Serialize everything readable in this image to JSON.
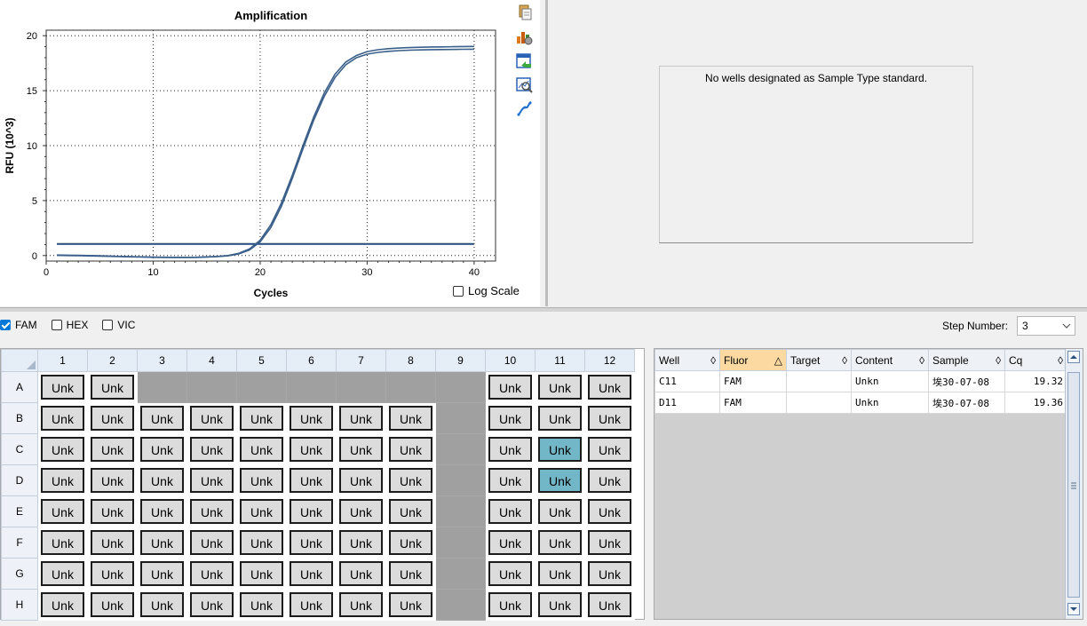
{
  "chart_data": {
    "type": "line",
    "title": "Amplification",
    "xlabel": "Cycles",
    "ylabel": "RFU (10^3)",
    "xlim": [
      0,
      42
    ],
    "ylim": [
      -0.5,
      20.5
    ],
    "xticks": [
      0,
      10,
      20,
      30,
      40
    ],
    "yticks": [
      0,
      5,
      10,
      15,
      20
    ],
    "grid": true,
    "threshold": 1.05,
    "x": [
      1,
      2,
      3,
      4,
      5,
      6,
      7,
      8,
      9,
      10,
      11,
      12,
      13,
      14,
      15,
      16,
      17,
      18,
      19,
      20,
      21,
      22,
      23,
      24,
      25,
      26,
      27,
      28,
      29,
      30,
      31,
      32,
      33,
      34,
      35,
      36,
      37,
      38,
      39,
      40
    ],
    "series": [
      {
        "values": [
          0.05,
          0.03,
          0.02,
          0.0,
          -0.02,
          -0.05,
          -0.08,
          -0.1,
          -0.12,
          -0.14,
          -0.15,
          -0.16,
          -0.16,
          -0.15,
          -0.12,
          -0.08,
          0.0,
          0.2,
          0.6,
          1.4,
          2.8,
          4.8,
          7.3,
          10.0,
          12.6,
          14.8,
          16.5,
          17.6,
          18.2,
          18.55,
          18.72,
          18.82,
          18.88,
          18.92,
          18.95,
          18.97,
          18.98,
          19.0,
          19.01,
          19.02
        ]
      },
      {
        "values": [
          0.02,
          0.0,
          -0.01,
          -0.03,
          -0.05,
          -0.07,
          -0.1,
          -0.12,
          -0.14,
          -0.16,
          -0.17,
          -0.18,
          -0.18,
          -0.17,
          -0.14,
          -0.1,
          -0.02,
          0.15,
          0.5,
          1.25,
          2.55,
          4.5,
          7.0,
          9.7,
          12.3,
          14.5,
          16.2,
          17.35,
          18.0,
          18.32,
          18.48,
          18.58,
          18.64,
          18.68,
          18.71,
          18.73,
          18.74,
          18.75,
          18.76,
          18.77
        ]
      }
    ]
  },
  "toolbar": {
    "icons": [
      "copy-icon",
      "chart-settings-icon",
      "export-icon",
      "zoom-icon",
      "curve-fit-icon"
    ]
  },
  "log_scale": {
    "label": "Log Scale",
    "checked": false
  },
  "standard_curve": {
    "message": "No wells designated as Sample Type standard."
  },
  "fluors": [
    {
      "label": "FAM",
      "checked": true
    },
    {
      "label": "HEX",
      "checked": false
    },
    {
      "label": "VIC",
      "checked": false
    }
  ],
  "step": {
    "label": "Step Number:",
    "value": "3"
  },
  "plate": {
    "columns": [
      "1",
      "2",
      "3",
      "4",
      "5",
      "6",
      "7",
      "8",
      "9",
      "10",
      "11",
      "12"
    ],
    "rows": [
      {
        "label": "A",
        "wells": [
          "Unk",
          "Unk",
          "",
          "",
          "",
          "",
          "",
          "",
          "",
          "Unk",
          "Unk",
          "Unk"
        ]
      },
      {
        "label": "B",
        "wells": [
          "Unk",
          "Unk",
          "Unk",
          "Unk",
          "Unk",
          "Unk",
          "Unk",
          "Unk",
          "",
          "Unk",
          "Unk",
          "Unk"
        ]
      },
      {
        "label": "C",
        "wells": [
          "Unk",
          "Unk",
          "Unk",
          "Unk",
          "Unk",
          "Unk",
          "Unk",
          "Unk",
          "",
          "Unk",
          "Unk",
          "Unk"
        ]
      },
      {
        "label": "D",
        "wells": [
          "Unk",
          "Unk",
          "Unk",
          "Unk",
          "Unk",
          "Unk",
          "Unk",
          "Unk",
          "",
          "Unk",
          "Unk",
          "Unk"
        ]
      },
      {
        "label": "E",
        "wells": [
          "Unk",
          "Unk",
          "Unk",
          "Unk",
          "Unk",
          "Unk",
          "Unk",
          "Unk",
          "",
          "Unk",
          "Unk",
          "Unk"
        ]
      },
      {
        "label": "F",
        "wells": [
          "Unk",
          "Unk",
          "Unk",
          "Unk",
          "Unk",
          "Unk",
          "Unk",
          "Unk",
          "",
          "Unk",
          "Unk",
          "Unk"
        ]
      },
      {
        "label": "G",
        "wells": [
          "Unk",
          "Unk",
          "Unk",
          "Unk",
          "Unk",
          "Unk",
          "Unk",
          "Unk",
          "",
          "Unk",
          "Unk",
          "Unk"
        ]
      },
      {
        "label": "H",
        "wells": [
          "Unk",
          "Unk",
          "Unk",
          "Unk",
          "Unk",
          "Unk",
          "Unk",
          "Unk",
          "",
          "Unk",
          "Unk",
          "Unk"
        ]
      }
    ],
    "selected": [
      "C11",
      "D11"
    ]
  },
  "results": {
    "columns": [
      {
        "label": "Well",
        "sort": "◊"
      },
      {
        "label": "Fluor",
        "sort": "△",
        "active": true
      },
      {
        "label": "Target",
        "sort": "◊"
      },
      {
        "label": "Content",
        "sort": "◊"
      },
      {
        "label": "Sample",
        "sort": "◊"
      },
      {
        "label": "Cq",
        "sort": "◊"
      }
    ],
    "rows": [
      [
        "C11",
        "FAM",
        "",
        "Unkn",
        "埃30-07-08",
        "19.32"
      ],
      [
        "D11",
        "FAM",
        "",
        "Unkn",
        "埃30-07-08",
        "19.36"
      ]
    ]
  },
  "colors": {
    "curve": "#3a5f8a",
    "threshold": "#23497e",
    "selected_well": "#72b7c7",
    "empty_well": "#a0a0a0"
  }
}
